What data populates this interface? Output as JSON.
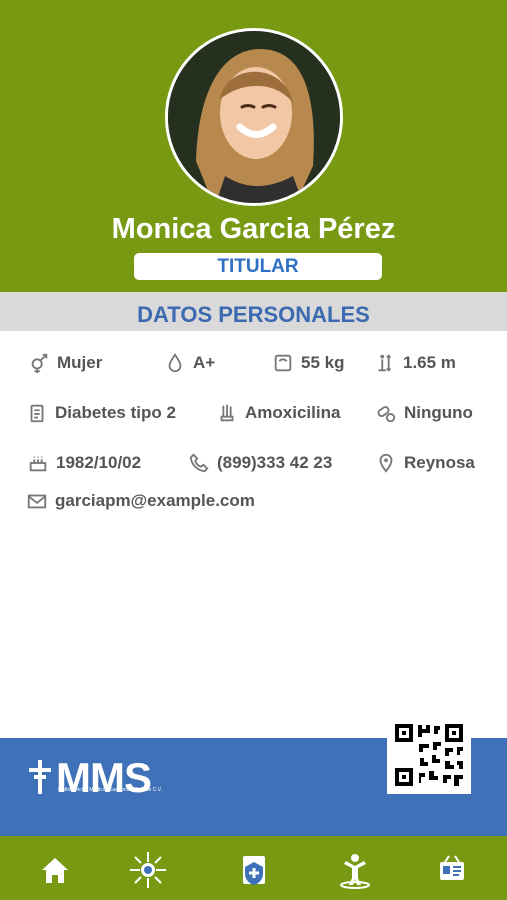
{
  "profile": {
    "name": "Monica Garcia Pérez",
    "role": "TITULAR",
    "avatar_alt": "profile photo"
  },
  "section": {
    "title": "DATOS PERSONALES"
  },
  "details": {
    "gender": "Mujer",
    "blood_type": "A+",
    "weight": "55 kg",
    "height": "1.65 m",
    "condition": "Diabetes tipo 2",
    "allergy": "Amoxicilina",
    "medication": "Ninguno",
    "birthdate": "1982/10/02",
    "phone": "(899)333 42 23",
    "city": "Reynosa",
    "email": "garciapm@example.com"
  },
  "brand": {
    "logo_text": "MMS",
    "subtitle": "Multiservicios Médicos Santander, S.A. de C.V."
  },
  "nav": {
    "items": [
      "home-icon",
      "network-icon",
      "medical-clipboard-icon",
      "wellness-icon",
      "id-card-icon"
    ]
  },
  "colors": {
    "header": "#789a12",
    "accent_blue": "#3f71b8",
    "text_gray": "#555555",
    "section_bg": "#d9d9d9"
  }
}
